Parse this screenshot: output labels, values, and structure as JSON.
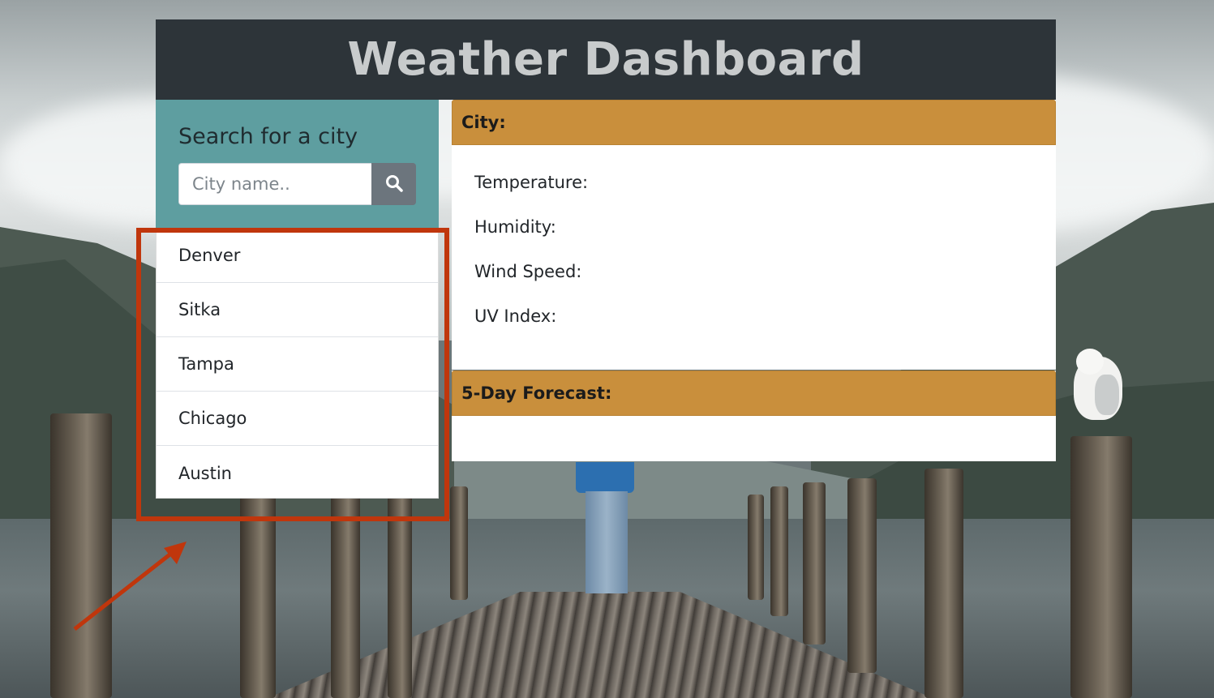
{
  "header": {
    "title": "Weather Dashboard"
  },
  "search": {
    "title": "Search for a city",
    "placeholder": "City name..",
    "button_icon": "search-icon"
  },
  "cities": [
    "Denver",
    "Sitka",
    "Tampa",
    "Chicago",
    "Austin"
  ],
  "current": {
    "city_label": "City:",
    "temperature_label": "Temperature:",
    "humidity_label": "Humidity:",
    "wind_label": "Wind Speed:",
    "uv_label": "UV Index:"
  },
  "forecast": {
    "title": "5-Day Forecast:"
  },
  "colors": {
    "header_bg": "#2d3439",
    "panel_bg": "#5e9ea0",
    "card_header": "#c98f3c",
    "annotation": "#c0360c"
  }
}
